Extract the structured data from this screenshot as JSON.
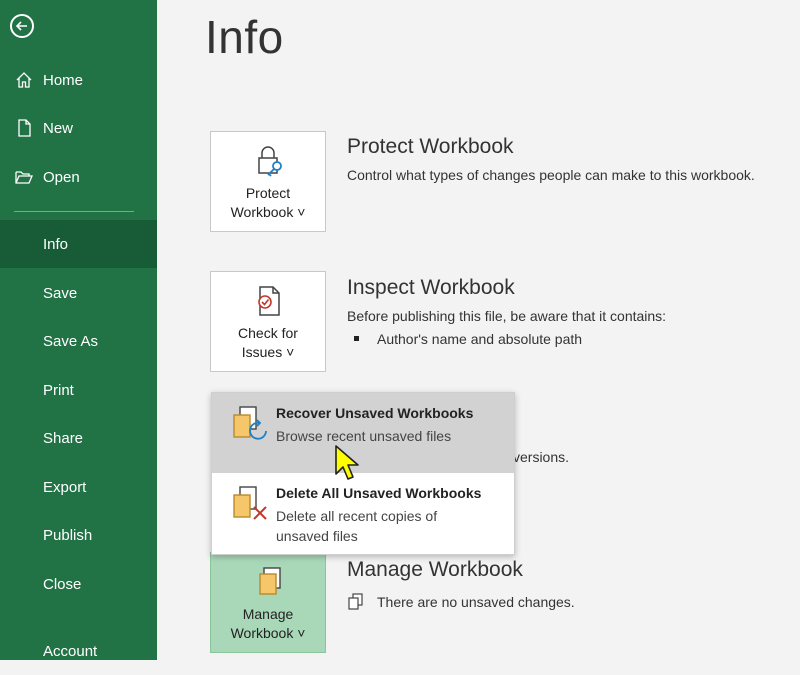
{
  "sidebar": {
    "items": [
      {
        "label": "Home"
      },
      {
        "label": "New"
      },
      {
        "label": "Open"
      },
      {
        "label": "Info"
      },
      {
        "label": "Save"
      },
      {
        "label": "Save As"
      },
      {
        "label": "Print"
      },
      {
        "label": "Share"
      },
      {
        "label": "Export"
      },
      {
        "label": "Publish"
      },
      {
        "label": "Close"
      },
      {
        "label": "Account"
      }
    ],
    "active": "Info"
  },
  "page": {
    "title": "Info"
  },
  "protect": {
    "tile_line1": "Protect",
    "tile_line2": "Workbook ˅",
    "title": "Protect Workbook",
    "desc": "Control what types of changes people can make to this workbook."
  },
  "inspect": {
    "tile_line1": "Check for",
    "tile_line2": "Issues ˅",
    "title": "Inspect Workbook",
    "desc": "Before publishing this file, be aware that it contains:",
    "bullets": [
      "Author's name and absolute path"
    ]
  },
  "versions": {
    "partial_text": "versions."
  },
  "dropdown": {
    "items": [
      {
        "title": "Recover Unsaved Workbooks",
        "desc": "Browse recent unsaved files",
        "state": "hover"
      },
      {
        "title": "Delete All Unsaved Workbooks",
        "desc_line1": "Delete all recent copies of",
        "desc_line2": "unsaved files"
      }
    ]
  },
  "manage": {
    "tile_line1": "Manage",
    "tile_line2": "Workbook ˅",
    "title": "Manage Workbook",
    "desc": "There are no unsaved changes."
  },
  "colors": {
    "sidebar": "#217346",
    "sidebar_active": "#185c37",
    "manage_tile": "#a9d8b8",
    "hover_item": "#d2d2d2",
    "cursor": "#ffff00"
  }
}
